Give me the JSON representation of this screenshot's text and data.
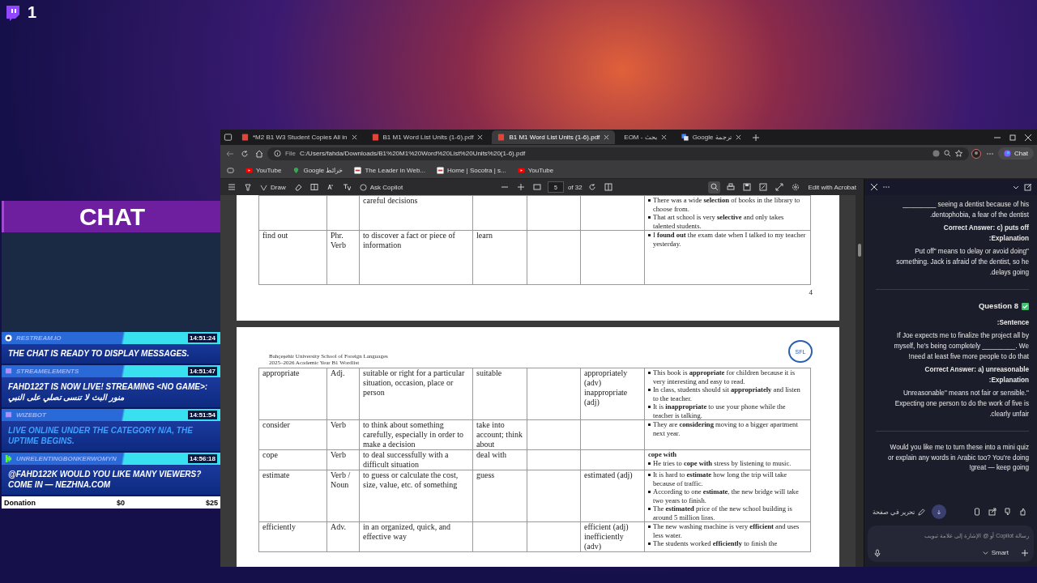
{
  "stream_overlay": {
    "viewer_count": "1",
    "chat_title": "CHAT",
    "messages": [
      {
        "kind": "restream",
        "user": "RESTREAM.IO",
        "time": "14:51:24",
        "text": "THE CHAT IS READY TO DISPLAY MESSAGES.",
        "action": false
      },
      {
        "kind": "twitch",
        "user": "STREAMELEMENTS",
        "time": "14:51:47",
        "text": "FAHD122T IS NOW LIVE! STREAMING <NO GAME>: منور البث لا تنسى تصلي على النبي",
        "action": false
      },
      {
        "kind": "twitch",
        "user": "WIZEBOT",
        "time": "14:51:54",
        "text": "LIVE ONLINE UNDER THE CATEGORY N/A, THE UPTIME BEGINS.",
        "action": true
      },
      {
        "kind": "kick",
        "user": "UNRELENTINGBONKERWOMYN",
        "time": "14:56:18",
        "text": "@FAHD122K WOULD YOU LIKE MANY VIEWERS? COME IN — NEZHNA.COM",
        "action": false
      }
    ],
    "donation": {
      "label": "Donation",
      "start": "$0",
      "goal": "$25",
      "level": 0
    }
  },
  "browser": {
    "tabs": [
      {
        "kind": "pdf",
        "title": "*M2 B1 W3 Student Copies All in",
        "selected": false
      },
      {
        "kind": "pdf",
        "title": "B1 M1 Word List Units (1-6).pdf",
        "selected": false
      },
      {
        "kind": "pdf",
        "title": "B1 M1 Word List Units (1-6).pdf",
        "selected": true
      },
      {
        "kind": "plain",
        "title": "EOM - بحث",
        "selected": false
      },
      {
        "kind": "translate",
        "title": "Google ترجمة",
        "selected": false
      }
    ],
    "address": {
      "scheme": "File",
      "url": "C:/Users/fahda/Downloads/B1%20M1%20Word%20List%20Units%20(1-6).pdf"
    },
    "chat_button": "Chat",
    "bookmarks": [
      {
        "kind": "youtube",
        "label": "YouTube"
      },
      {
        "kind": "maps",
        "label": "Google خرائط"
      },
      {
        "kind": "site",
        "label": "The Leader in Web..."
      },
      {
        "kind": "site",
        "label": "Home | Socotra | s..."
      },
      {
        "kind": "youtube",
        "label": "YouTube"
      }
    ],
    "pdf_toolbar": {
      "draw": "Draw",
      "ask": "Ask Copilot",
      "page": "5",
      "page_count": "of 32",
      "edit": "Edit with Acrobat"
    },
    "pdf": {
      "page_one": {
        "rows": [
          {
            "word": "",
            "pos": "",
            "meaning": "careful decisions",
            "synonym": "",
            "forms": "",
            "examples": [
              "There was a wide **selection** of books in the library to choose from.",
              "That art school is very **selective** and only takes talented students."
            ]
          },
          {
            "word": "find out",
            "pos": "Phr. Verb",
            "meaning": "to discover a fact or piece of information",
            "synonym": "learn",
            "forms": "",
            "examples": [
              "I **found out** the exam date when I talked to my teacher yesterday."
            ]
          }
        ],
        "page_number": "4"
      },
      "page_two": {
        "header": [
          "Bahçeşehir University School of Foreign Languages",
          "2025–2026 Academic Year B1 Wordlist"
        ],
        "logo": "SFL",
        "rows": [
          {
            "word": "appropriate",
            "pos": "Adj.",
            "meaning": "suitable or right for a particular situation, occasion, place or person",
            "synonym": "suitable",
            "forms": "appropriately (adv) inappropriate (adj)",
            "examples": [
              "This book is **appropriate** for children because it is very interesting and easy to read.",
              "In class, students should sit **appropriately** and listen to the teacher.",
              "It is **inappropriate** to use your phone while the teacher is talking."
            ]
          },
          {
            "word": "consider",
            "pos": "Verb",
            "meaning": "to think about something carefully, especially in order to make a decision",
            "synonym": "take into account; think about",
            "forms": "",
            "examples": [
              "They are **considering** moving to a bigger apartment next year."
            ]
          },
          {
            "word": "cope",
            "pos": "Verb",
            "meaning": "to deal successfully with a difficult situation",
            "synonym": "deal with",
            "forms": "",
            "example_heading": "cope with",
            "examples": [
              "He tries to **cope with** stress by listening to music."
            ]
          },
          {
            "word": "estimate",
            "pos": "Verb / Noun",
            "meaning": "to guess or calculate the cost, size, value, etc. of something",
            "synonym": "guess",
            "forms": "estimated (adj)",
            "examples": [
              "It is hard to **estimate** how long the trip will take because of traffic.",
              "According to one **estimate**, the new bridge will take two years to finish.",
              "The **estimated** price of the new school building is around 5 million liras."
            ]
          },
          {
            "word": "efficiently",
            "pos": "Adv.",
            "meaning": "in an organized, quick, and effective way",
            "synonym": "",
            "forms": "efficient (adj) inefficiently (adv)",
            "examples": [
              "The new washing machine is very **efficient** and uses less water.",
              "The students worked **efficiently** to finish the"
            ]
          }
        ]
      }
    },
    "copilot": {
      "blocks": [
        {
          "kind": "text",
          "lines": [
            "_________ seeing a dentist because of his",
            ".dentophobia, a fear of the dentist"
          ]
        },
        {
          "kind": "bold",
          "lines": [
            "Correct Answer: c) puts off",
            ":Explanation"
          ]
        },
        {
          "kind": "text",
          "lines": [
            "Put off\" means to delay or avoid doing\"",
            "something. Jack is afraid of the dentist, so he",
            ".delays going"
          ]
        },
        {
          "kind": "divider"
        },
        {
          "kind": "heading",
          "lines": [
            "Question 8"
          ]
        },
        {
          "kind": "bold",
          "lines": [
            ":Sentence"
          ]
        },
        {
          "kind": "text",
          "lines": [
            "If Joe expects me to finalize the project all by",
            "myself, he's being completely _________. We",
            "!need at least five more people to do that"
          ]
        },
        {
          "kind": "bold",
          "lines": [
            "Correct Answer: a) unreasonable",
            ":Explanation"
          ]
        },
        {
          "kind": "text",
          "lines": [
            "Unreasonable\" means not fair or sensible.\"",
            "Expecting one person to do the work of five is",
            ".clearly unfair"
          ]
        },
        {
          "kind": "divider"
        },
        {
          "kind": "text",
          "lines": [
            "Would you like me to turn these into a mini quiz",
            "or explain any words in Arabic too? You're doing",
            "!great — keep going"
          ]
        }
      ],
      "edit_in_page": "تحرير في صفحة",
      "placeholder": "رسالة Copilot أو @ الإشارة إلى علامة تبويب",
      "mode": "Smart"
    }
  }
}
